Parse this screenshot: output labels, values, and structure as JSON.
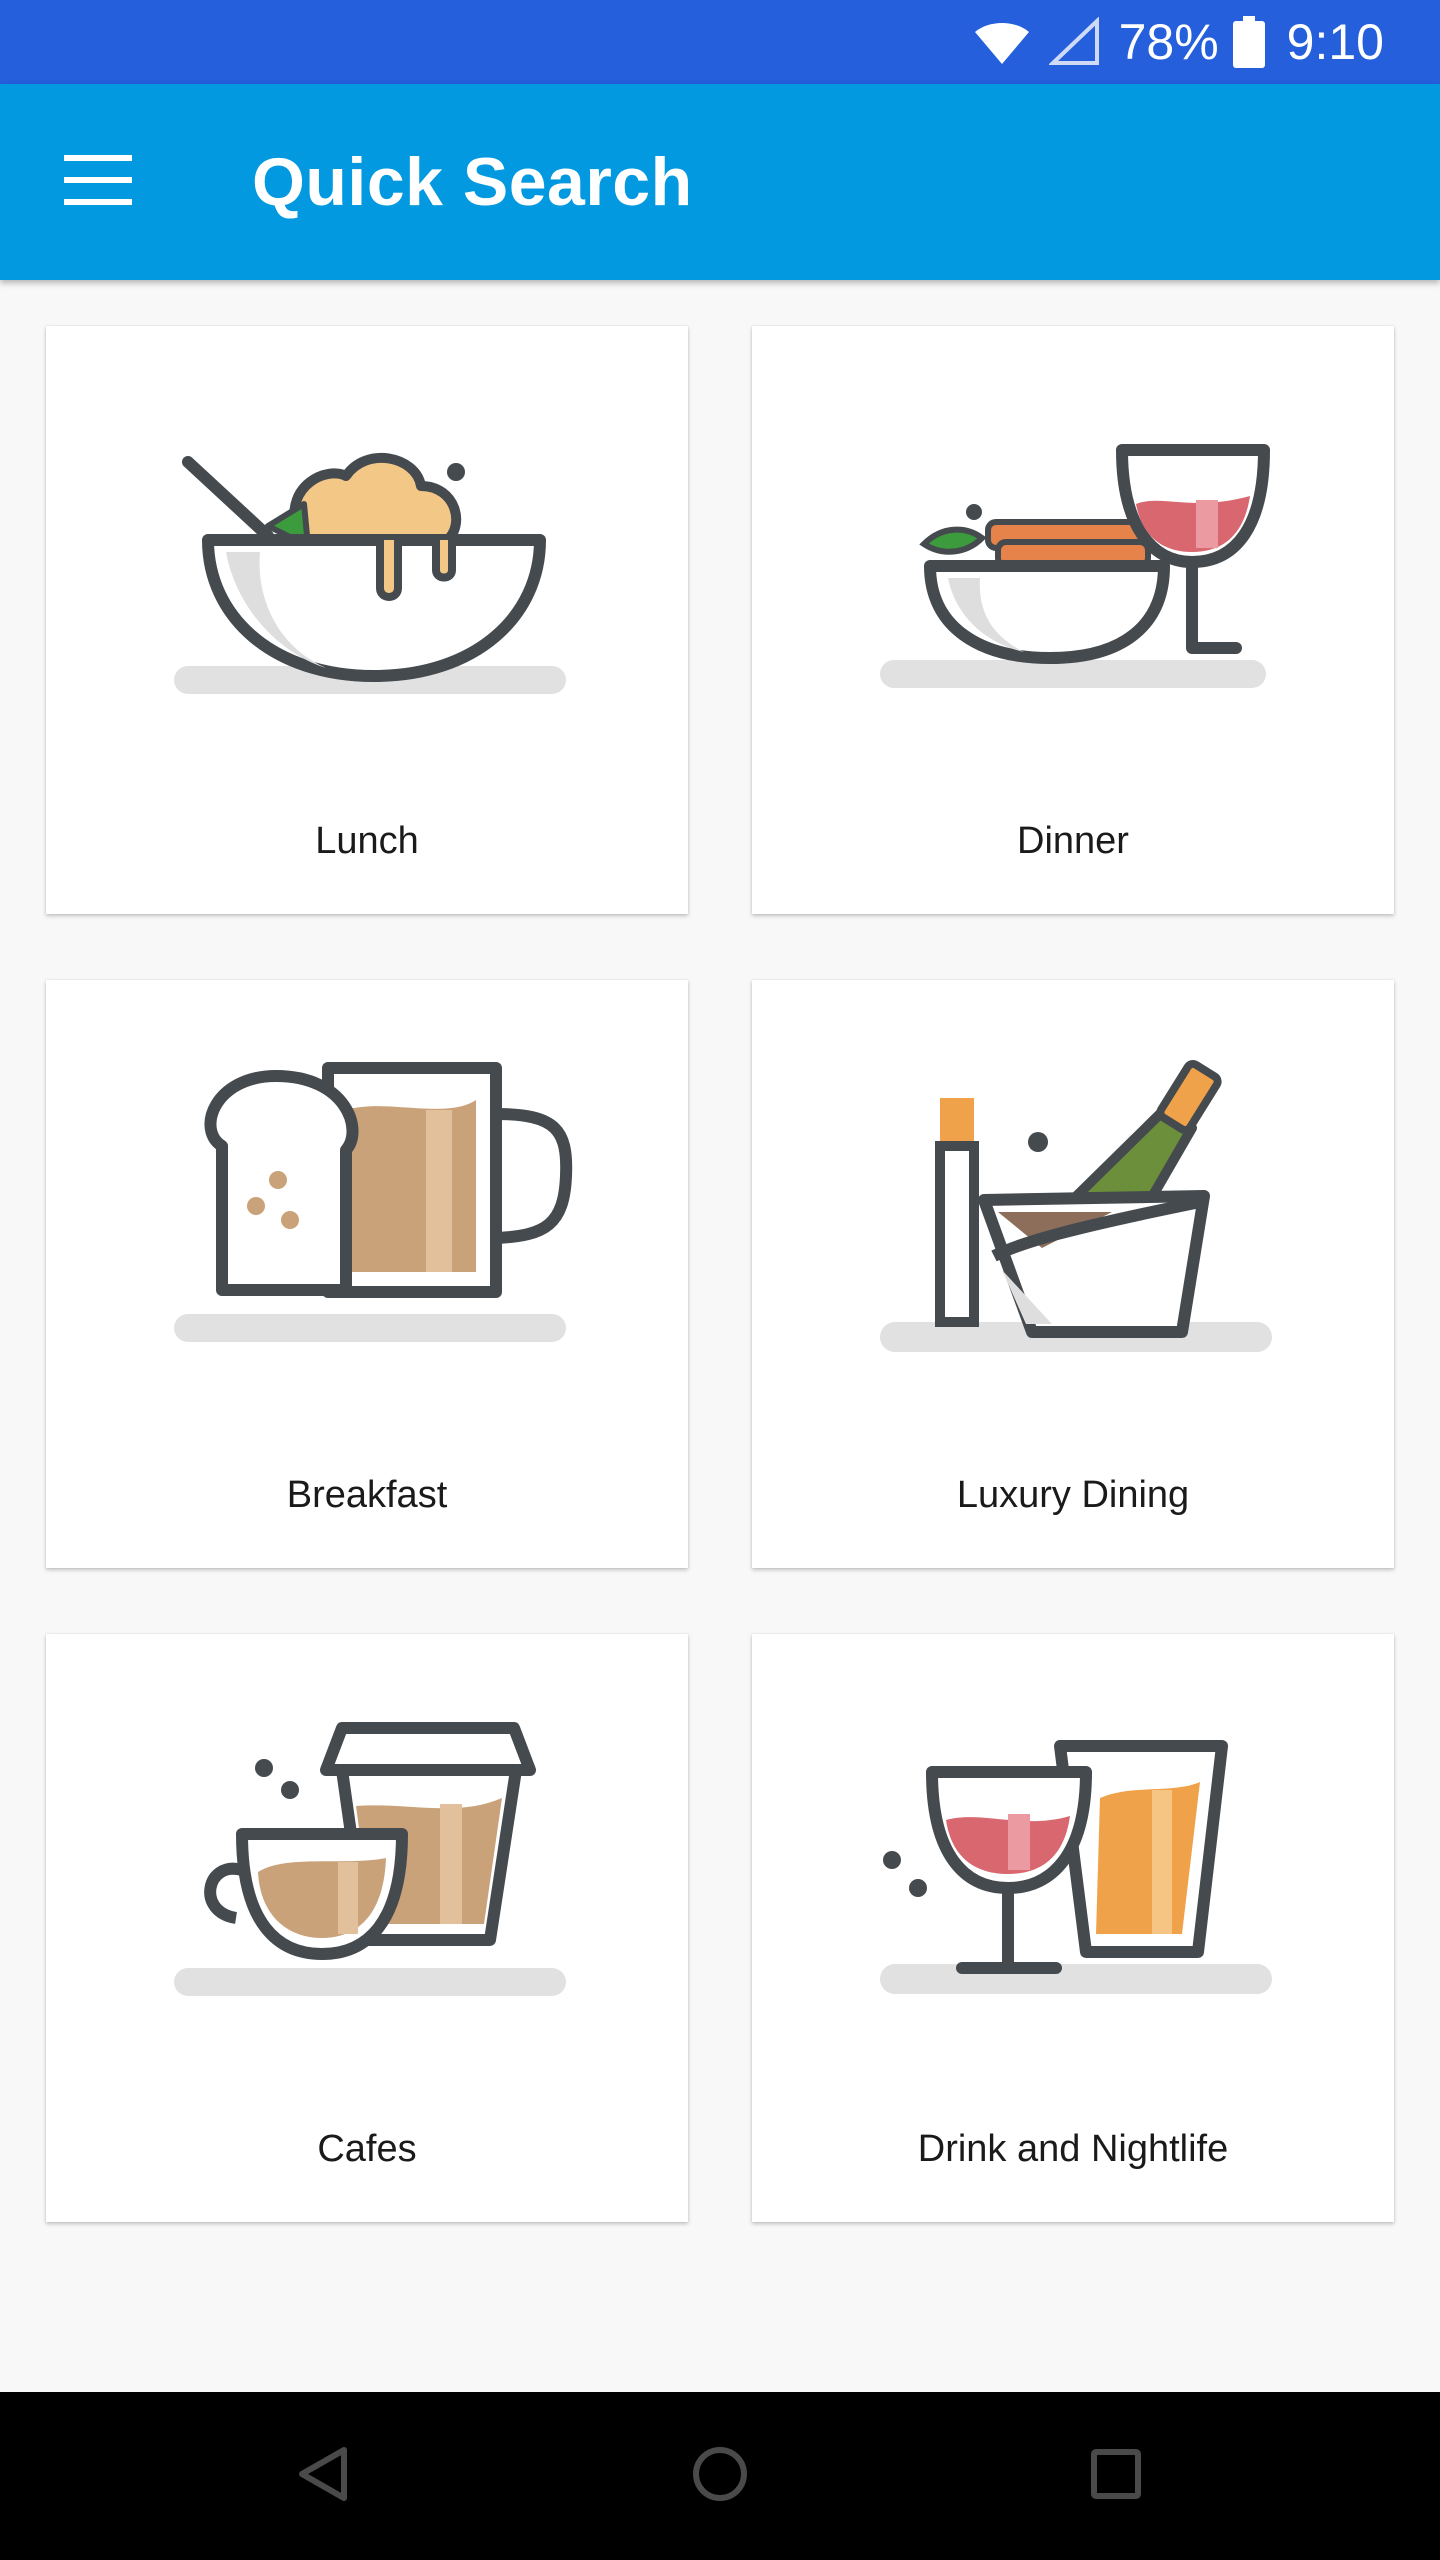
{
  "status_bar": {
    "battery": "78%",
    "time": "9:10",
    "icons": [
      "wifi-icon",
      "cell-signal-icon",
      "battery-icon"
    ]
  },
  "app_bar": {
    "title": "Quick Search",
    "menu_icon": "hamburger-menu-icon"
  },
  "categories": [
    {
      "label": "Lunch",
      "icon": "salad-bowl-icon"
    },
    {
      "label": "Dinner",
      "icon": "plate-and-wine-icon"
    },
    {
      "label": "Breakfast",
      "icon": "toast-and-mug-icon"
    },
    {
      "label": "Luxury Dining",
      "icon": "champagne-bucket-icon"
    },
    {
      "label": "Cafes",
      "icon": "coffee-cups-icon"
    },
    {
      "label": "Drink and Nightlife",
      "icon": "wine-and-beer-icon"
    }
  ],
  "nav_bar": {
    "icons": [
      "back-icon",
      "home-icon",
      "recents-icon"
    ]
  },
  "colors": {
    "status_bar": "#255fdc",
    "app_bar": "#0299e0",
    "background": "#f8f8f8",
    "icon_stroke": "#454a4f",
    "wine": "#d9676f",
    "coffee": "#c9a27a",
    "orange": "#f0a24a",
    "green": "#3c9b3c"
  }
}
